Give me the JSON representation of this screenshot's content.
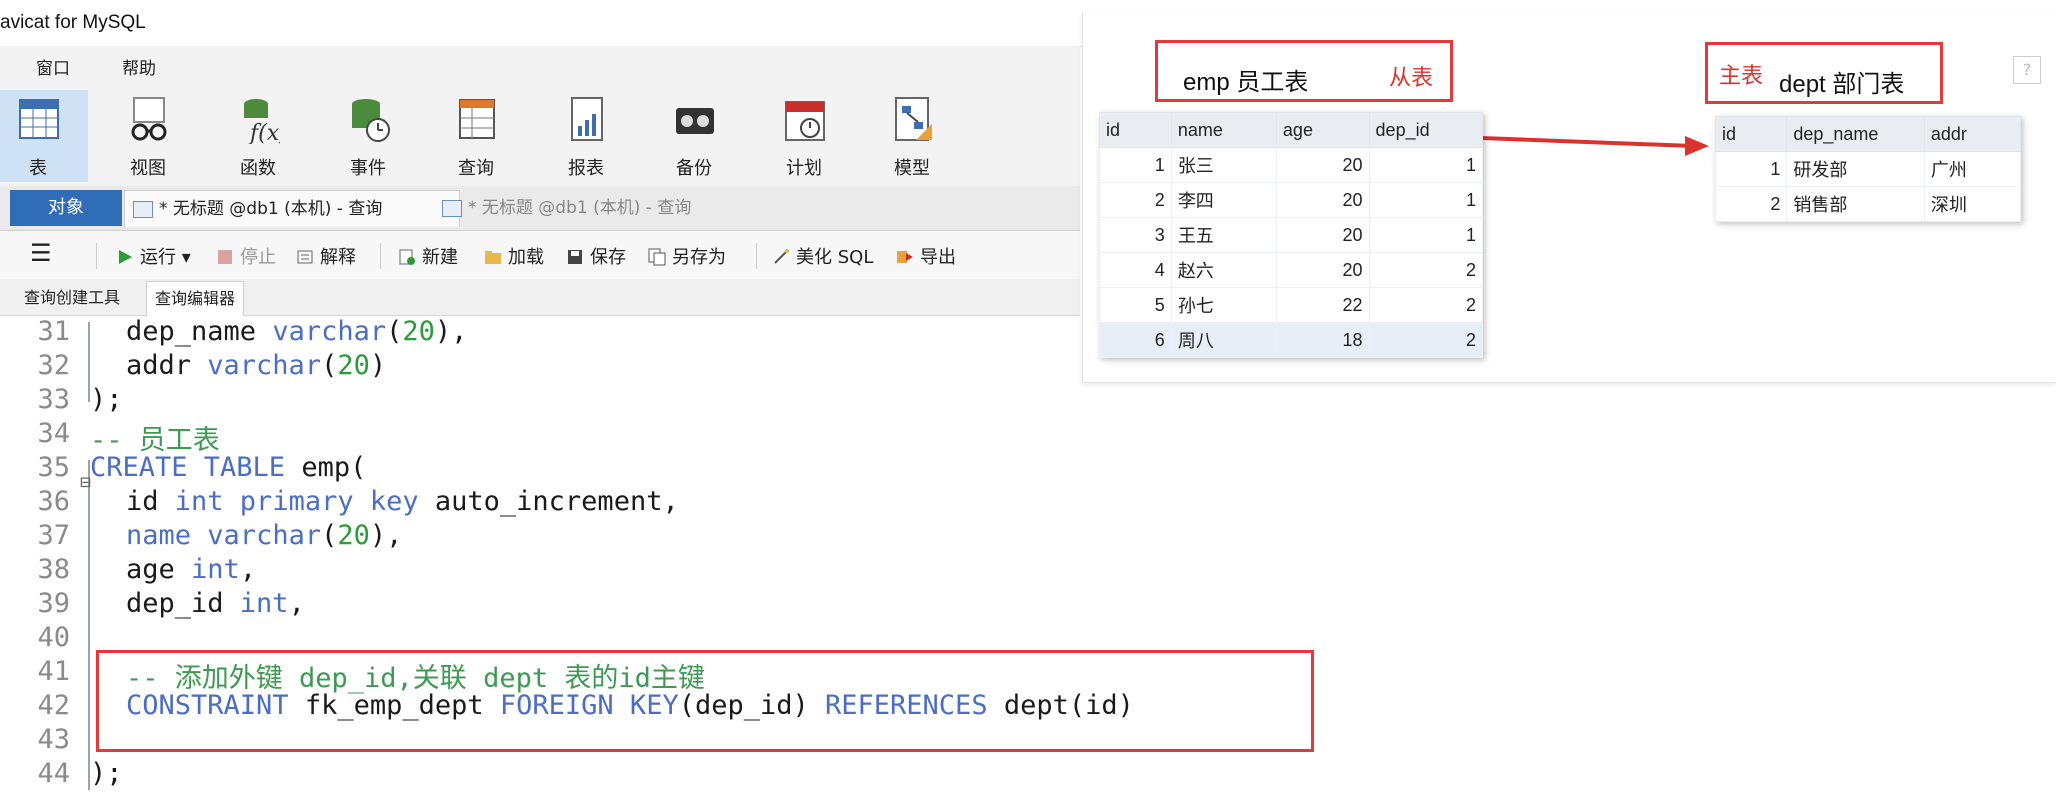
{
  "window": {
    "title": "avicat for MySQL"
  },
  "menu": {
    "items": [
      "窗口",
      "帮助"
    ]
  },
  "toolbar": {
    "items": [
      {
        "label": "表",
        "icon": "table-icon",
        "active": true
      },
      {
        "label": "视图",
        "icon": "view-glasses-icon"
      },
      {
        "label": "函数",
        "icon": "function-fx-icon"
      },
      {
        "label": "事件",
        "icon": "event-clock-icon"
      },
      {
        "label": "查询",
        "icon": "query-table-icon"
      },
      {
        "label": "报表",
        "icon": "report-chart-icon"
      },
      {
        "label": "备份",
        "icon": "backup-tape-icon"
      },
      {
        "label": "计划",
        "icon": "schedule-calendar-icon"
      },
      {
        "label": "模型",
        "icon": "model-diagram-icon"
      }
    ]
  },
  "tabs": {
    "objects": "对象",
    "query_tabs": [
      "* 无标题 @db1 (本机) - 查询",
      "* 无标题 @db1 (本机) - 查询"
    ]
  },
  "actions": {
    "menu": "☰",
    "run": "运行",
    "stop": "停止",
    "explain": "解释",
    "new": "新建",
    "load": "加载",
    "save": "保存",
    "save_as": "另存为",
    "beautify": "美化 SQL",
    "export": "导出"
  },
  "subtabs": [
    "查询创建工具",
    "查询编辑器"
  ],
  "editor": {
    "lines": [
      {
        "no": "31",
        "segments": [
          [
            "",
            "dep_name "
          ],
          [
            "kw",
            "varchar"
          ],
          [
            "",
            "("
          ],
          [
            "num",
            "20"
          ],
          [
            "",
            "),"
          ]
        ]
      },
      {
        "no": "32",
        "segments": [
          [
            "",
            "addr "
          ],
          [
            "kw",
            "varchar"
          ],
          [
            "",
            "("
          ],
          [
            "num",
            "20"
          ],
          [
            "",
            ")"
          ]
        ]
      },
      {
        "no": "33",
        "segments": [
          [
            "",
            ");"
          ]
        ]
      },
      {
        "no": "34",
        "segments": [
          [
            "cm",
            "-- 员工表"
          ]
        ]
      },
      {
        "no": "35",
        "segments": [
          [
            "kw",
            "CREATE TABLE"
          ],
          [
            "",
            " emp("
          ]
        ]
      },
      {
        "no": "36",
        "segments": [
          [
            "",
            "id "
          ],
          [
            "kw",
            "int primary key"
          ],
          [
            "",
            " auto_increment,"
          ]
        ]
      },
      {
        "no": "37",
        "segments": [
          [
            "kw",
            "name"
          ],
          [
            "",
            " "
          ],
          [
            "kw",
            "varchar"
          ],
          [
            "",
            "("
          ],
          [
            "num",
            "20"
          ],
          [
            "",
            "),"
          ]
        ]
      },
      {
        "no": "38",
        "segments": [
          [
            "",
            "age "
          ],
          [
            "kw",
            "int"
          ],
          [
            "",
            ","
          ]
        ]
      },
      {
        "no": "39",
        "segments": [
          [
            "",
            "dep_id "
          ],
          [
            "kw",
            "int"
          ],
          [
            "",
            ","
          ]
        ]
      },
      {
        "no": "40",
        "segments": []
      },
      {
        "no": "41",
        "segments": [
          [
            "cm",
            "-- 添加外键 dep_id,关联 dept 表的id主键"
          ]
        ]
      },
      {
        "no": "42",
        "segments": [
          [
            "kw",
            "CONSTRAINT"
          ],
          [
            "",
            " fk_emp_dept "
          ],
          [
            "kw",
            "FOREIGN KEY"
          ],
          [
            "",
            "(dep_id) "
          ],
          [
            "kw",
            "REFERENCES"
          ],
          [
            "",
            " dept(id)"
          ]
        ]
      },
      {
        "no": "43",
        "segments": []
      },
      {
        "no": "44",
        "segments": [
          [
            "",
            ");"
          ]
        ]
      }
    ]
  },
  "diagram": {
    "emp": {
      "title": "emp 员工表",
      "tag": "从表",
      "columns": [
        "id",
        "name",
        "age",
        "dep_id"
      ],
      "rows": [
        [
          "1",
          "张三",
          "20",
          "1"
        ],
        [
          "2",
          "李四",
          "20",
          "1"
        ],
        [
          "3",
          "王五",
          "20",
          "1"
        ],
        [
          "4",
          "赵六",
          "20",
          "2"
        ],
        [
          "5",
          "孙七",
          "22",
          "2"
        ],
        [
          "6",
          "周八",
          "18",
          "2"
        ]
      ]
    },
    "dept": {
      "title": "dept 部门表",
      "tag": "主表",
      "columns": [
        "id",
        "dep_name",
        "addr"
      ],
      "rows": [
        [
          "1",
          "研发部",
          "广州"
        ],
        [
          "2",
          "销售部",
          "深圳"
        ]
      ]
    },
    "help": "?"
  },
  "colors": {
    "accent": "#2f6db6",
    "highlight": "#e23a3a",
    "keyword": "#4b6ec4",
    "comment": "#3d9a52"
  }
}
